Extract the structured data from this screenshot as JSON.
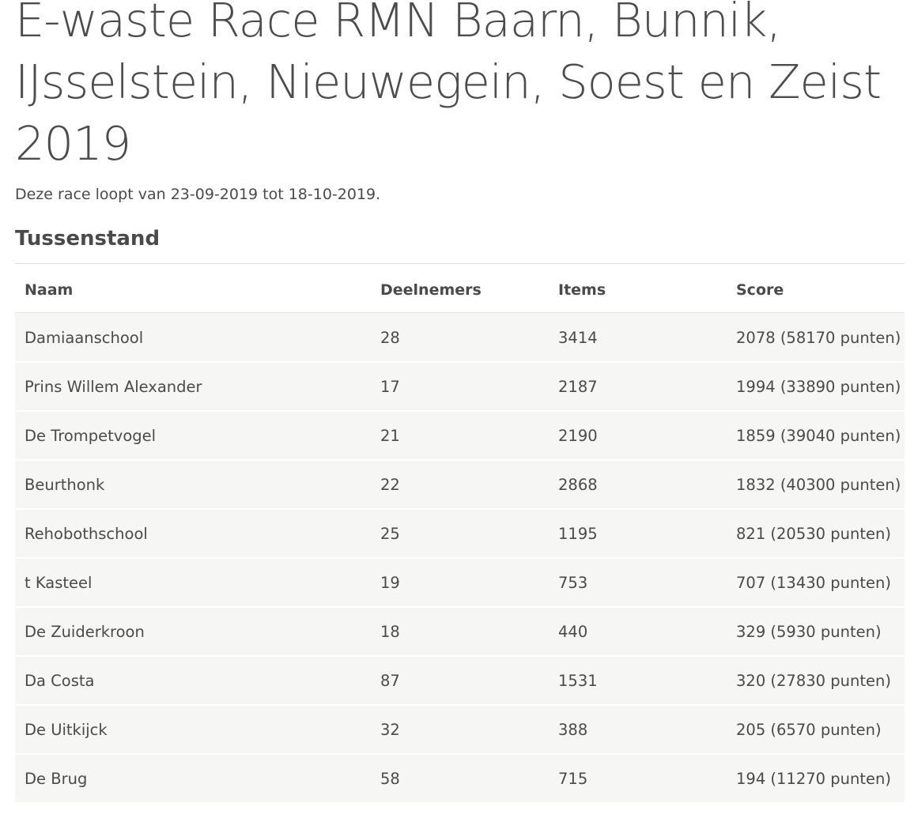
{
  "page": {
    "title_lines": [
      "E-waste Race RMN Baarn, Bunnik,",
      "IJsselstein, Nieuwegein, Soest en Zeist",
      "2019"
    ],
    "subtitle": "Deze race loopt van 23-09-2019 tot 18-10-2019.",
    "section_heading": "Tussenstand"
  },
  "table": {
    "headers": {
      "naam": "Naam",
      "deelnemers": "Deelnemers",
      "items": "Items",
      "score": "Score"
    },
    "rows": [
      {
        "naam": "Damiaanschool",
        "deelnemers": "28",
        "items": "3414",
        "score": "2078 (58170 punten)"
      },
      {
        "naam": "Prins Willem Alexander",
        "deelnemers": "17",
        "items": "2187",
        "score": "1994 (33890 punten)"
      },
      {
        "naam": "De Trompetvogel",
        "deelnemers": "21",
        "items": "2190",
        "score": "1859 (39040 punten)"
      },
      {
        "naam": "Beurthonk",
        "deelnemers": "22",
        "items": "2868",
        "score": "1832 (40300 punten)"
      },
      {
        "naam": "Rehobothschool",
        "deelnemers": "25",
        "items": "1195",
        "score": "821 (20530 punten)"
      },
      {
        "naam": "t Kasteel",
        "deelnemers": "19",
        "items": "753",
        "score": "707 (13430 punten)"
      },
      {
        "naam": "De Zuiderkroon",
        "deelnemers": "18",
        "items": "440",
        "score": "329 (5930 punten)"
      },
      {
        "naam": "Da Costa",
        "deelnemers": "87",
        "items": "1531",
        "score": "320 (27830 punten)"
      },
      {
        "naam": "De Uitkijck",
        "deelnemers": "32",
        "items": "388",
        "score": "205 (6570 punten)"
      },
      {
        "naam": "De Brug",
        "deelnemers": "58",
        "items": "715",
        "score": "194 (11270 punten)"
      }
    ]
  },
  "colors": {
    "text": "#4a4a4a",
    "row_background": "#f6f6f4",
    "border": "#dcdcdc"
  }
}
